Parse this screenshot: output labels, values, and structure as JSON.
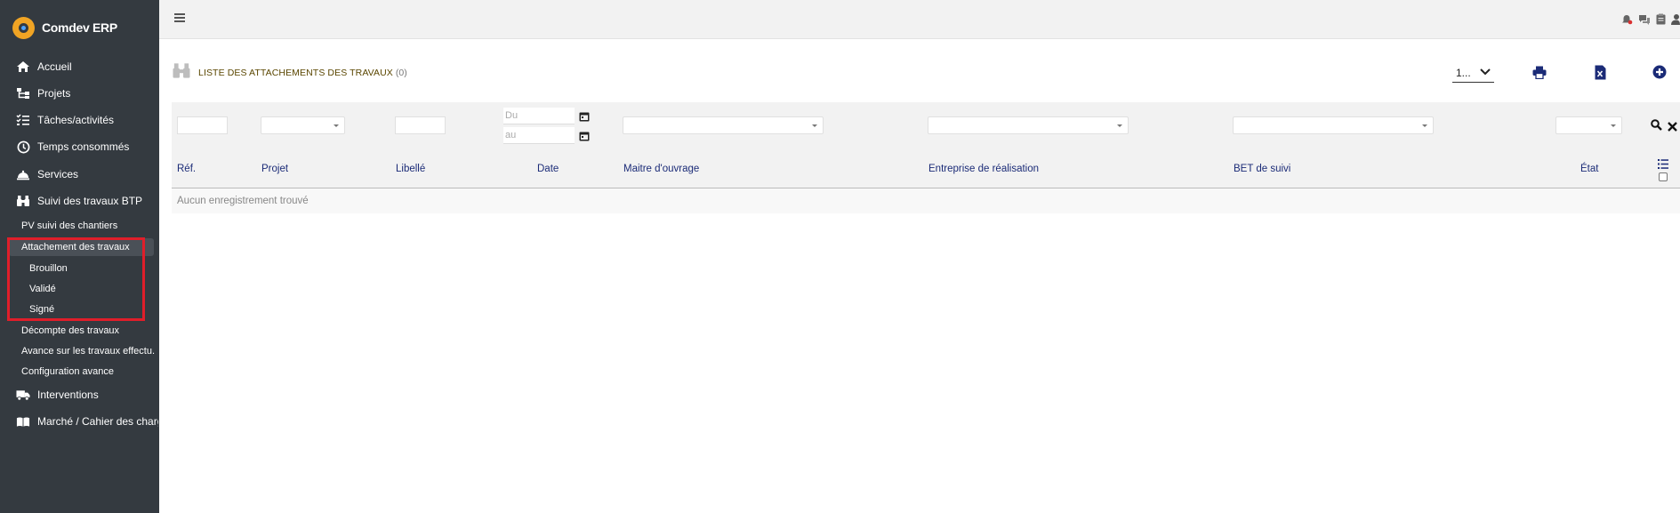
{
  "app": {
    "name": "Comdev ERP"
  },
  "sidebar": {
    "items": [
      {
        "label": "Accueil",
        "icon": "home-icon"
      },
      {
        "label": "Projets",
        "icon": "sitemap-icon"
      },
      {
        "label": "Tâches/activités",
        "icon": "tasks-icon"
      },
      {
        "label": "Temps consommés",
        "icon": "clock-icon"
      },
      {
        "label": "Services",
        "icon": "bell-service-icon"
      },
      {
        "label": "Suivi des travaux BTP",
        "icon": "binoculars-icon"
      },
      {
        "label": "Interventions",
        "icon": "truck-icon"
      },
      {
        "label": "Marché / Cahier des charg",
        "icon": "book-icon"
      }
    ],
    "btp_sub": [
      {
        "label": "PV suivi des chantiers"
      },
      {
        "label": "Attachement des travaux"
      },
      {
        "label": "Décompte des travaux"
      },
      {
        "label": "Avance sur les travaux effectu..."
      },
      {
        "label": "Configuration avance"
      }
    ],
    "attachement_sub": [
      {
        "label": "Brouillon"
      },
      {
        "label": "Validé"
      },
      {
        "label": "Signé"
      }
    ]
  },
  "header": {
    "title": "LISTE DES ATTACHEMENTS DES TRAVAUX",
    "count": "(0)",
    "pager_value": "1..."
  },
  "filters": {
    "date_from_placeholder": "Du",
    "date_to_placeholder": "au"
  },
  "table": {
    "columns": [
      "Réf.",
      "Projet",
      "Libellé",
      "Date",
      "Maitre d'ouvrage",
      "Entreprise de réalisation",
      "BET de suivi",
      "État"
    ],
    "empty_message": "Aucun enregistrement trouvé"
  },
  "colors": {
    "sidebar_bg": "#343a40",
    "accent_blue": "#1b2b77",
    "highlight_red": "#e01e2a",
    "brand_orange": "#f0a424"
  }
}
